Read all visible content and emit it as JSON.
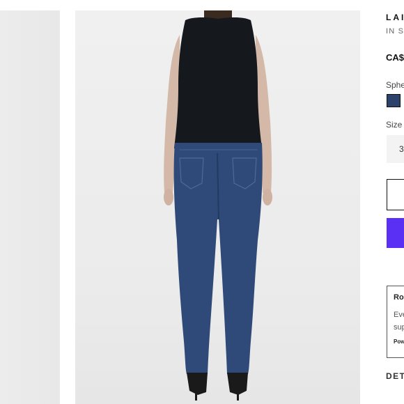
{
  "product": {
    "title": "LAI",
    "subtitle": "IN S",
    "price": "CA$"
  },
  "options": {
    "color_label": "Sphe",
    "selected_color": "#2c426a",
    "size_label": "Size",
    "size_value": "3"
  },
  "notice": {
    "title": "Ro",
    "line1": "Eve",
    "line2": "sup",
    "powered": "Pow"
  },
  "tabs": {
    "details": "DET"
  },
  "colors": {
    "accent": "#5a31f4",
    "denim": "#2f4a78",
    "top": "#15181d"
  },
  "images": {
    "main_alt_icon": "product-photo-back-view",
    "side_alt_icon": "product-photo-partial"
  }
}
